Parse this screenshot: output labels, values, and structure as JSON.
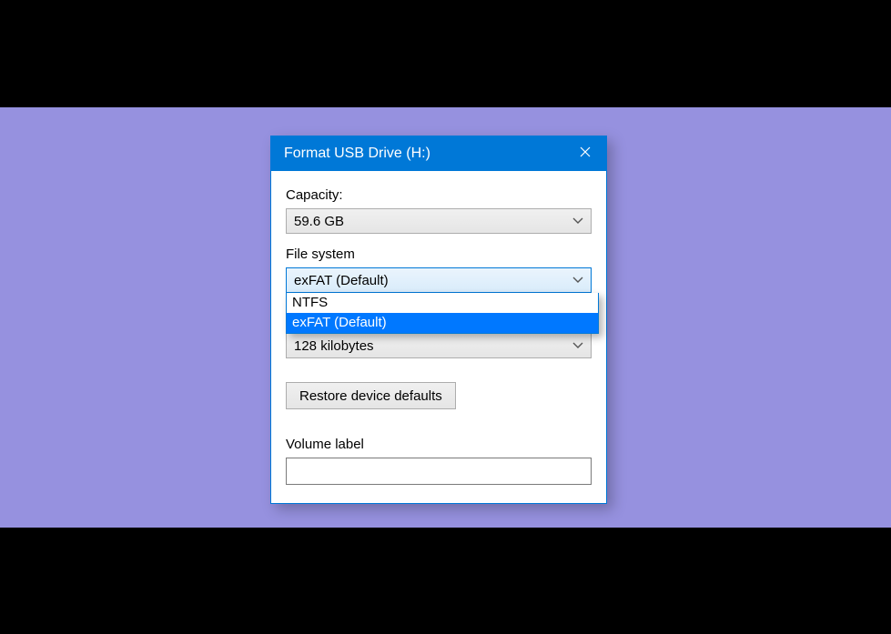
{
  "window": {
    "title": "Format USB Drive (H:)"
  },
  "capacity": {
    "label": "Capacity:",
    "value": "59.6 GB"
  },
  "filesystem": {
    "label": "File system",
    "value": "exFAT (Default)",
    "options": {
      "0": "NTFS",
      "1": "exFAT (Default)"
    }
  },
  "allocation": {
    "value": "128 kilobytes"
  },
  "restore": {
    "label": "Restore device defaults"
  },
  "volume": {
    "label": "Volume label",
    "value": ""
  }
}
